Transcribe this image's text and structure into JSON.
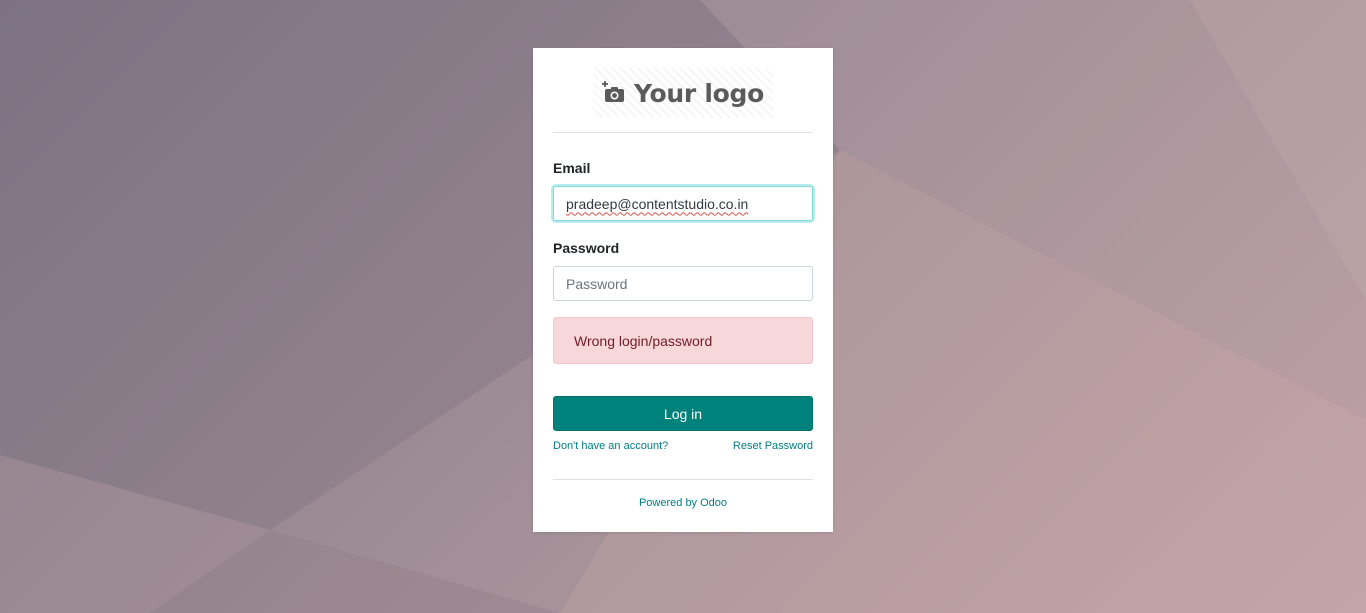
{
  "logo": {
    "text": "Your logo",
    "icon": "camera-plus-icon"
  },
  "form": {
    "email_label": "Email",
    "email_value": "pradeep@contentstudio.co.in",
    "password_label": "Password",
    "password_placeholder": "Password",
    "error_message": "Wrong login/password",
    "login_button": "Log in"
  },
  "links": {
    "signup": "Don't have an account?",
    "reset_password": "Reset Password"
  },
  "footer": {
    "powered_by": "Powered by Odoo"
  },
  "colors": {
    "primary": "#00827c",
    "link": "#017e84",
    "error_bg": "#f8d7da",
    "error_text": "#721c24",
    "focus_border": "#7fdbdb"
  }
}
